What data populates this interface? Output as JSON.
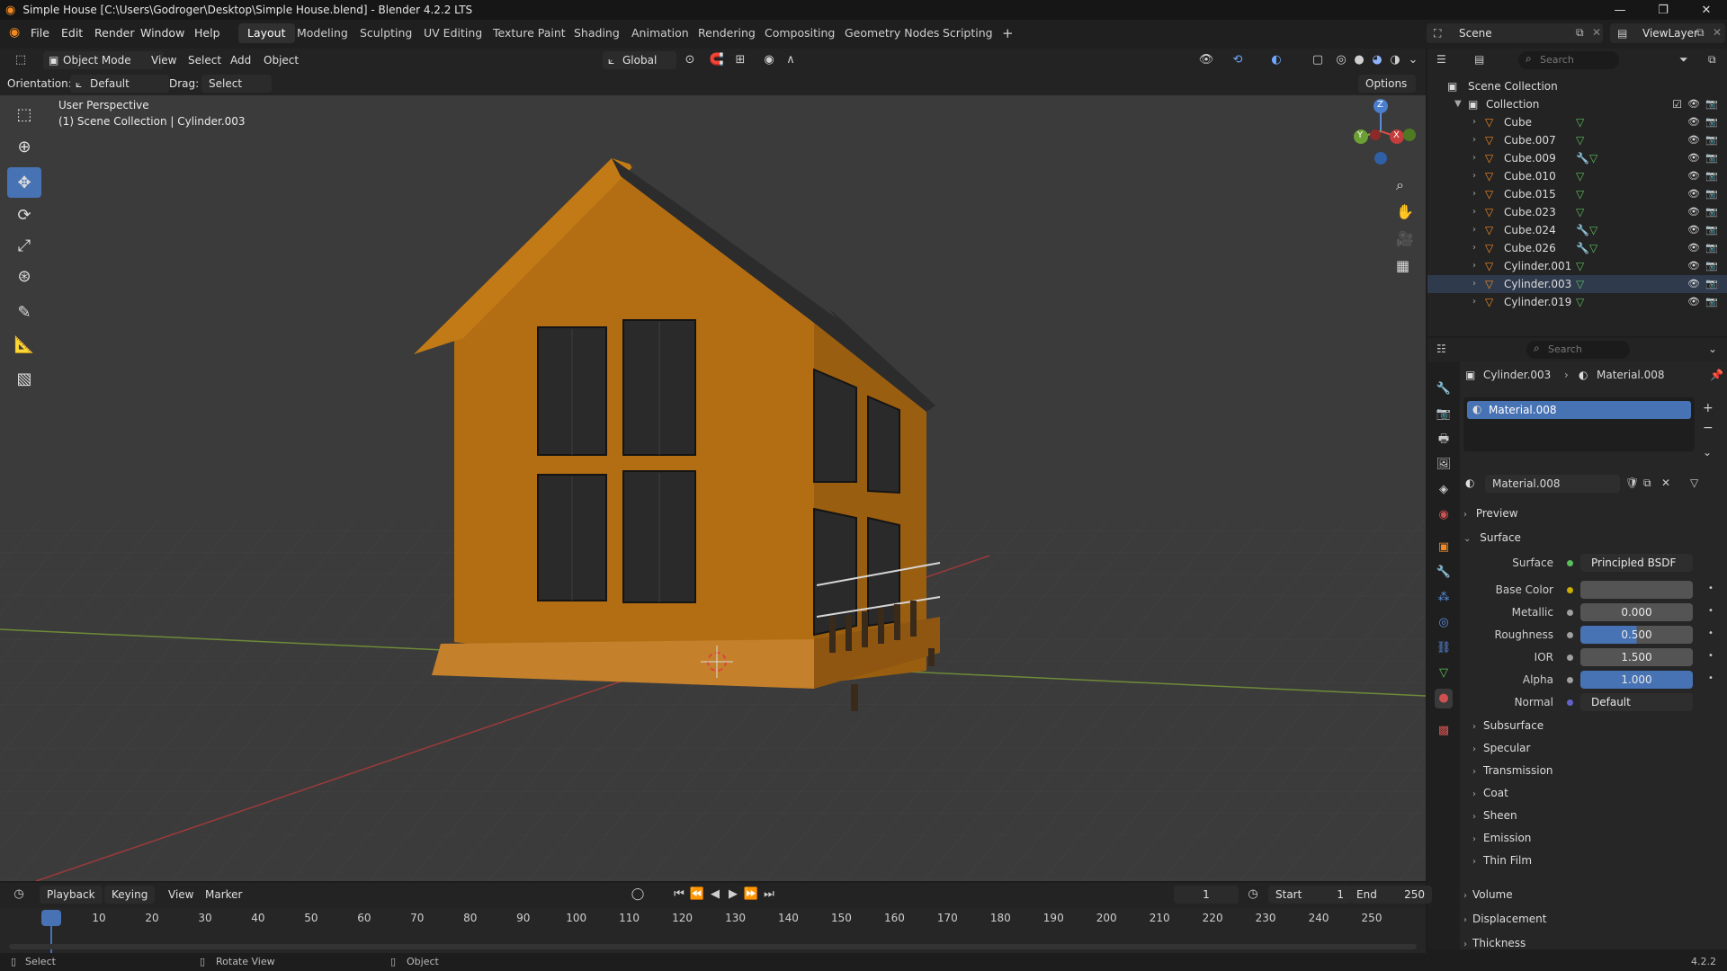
{
  "window": {
    "title": "Simple House [C:\\Users\\Godroger\\Desktop\\Simple House.blend] - Blender 4.2.2 LTS",
    "minimize": "—",
    "maximize": "❐",
    "close": "✕"
  },
  "menu": [
    "File",
    "Edit",
    "Render",
    "Window",
    "Help"
  ],
  "workspaces": [
    "Layout",
    "Modeling",
    "Sculpting",
    "UV Editing",
    "Texture Paint",
    "Shading",
    "Animation",
    "Rendering",
    "Compositing",
    "Geometry Nodes",
    "Scripting"
  ],
  "workspace_add": "+",
  "scene": {
    "name": "Scene",
    "view_layer": "ViewLayer"
  },
  "viewport_header": {
    "mode": "Object Mode",
    "menus": [
      "View",
      "Select",
      "Add",
      "Object"
    ],
    "transform_orientation": "Global",
    "options": "Options"
  },
  "tool_header": {
    "orientation_label": "Orientation:",
    "orientation_value": "Default",
    "drag_label": "Drag:",
    "drag_value": "Select Box"
  },
  "viewport": {
    "perspective": "User Perspective",
    "context": "(1) Scene Collection | Cylinder.003",
    "gizmo_axes": [
      "Z",
      "Y",
      "X"
    ]
  },
  "outliner": {
    "search_placeholder": "Search",
    "root": "Scene Collection",
    "collection": "Collection",
    "items": [
      {
        "name": "Cube",
        "mods": false
      },
      {
        "name": "Cube.007",
        "mods": false
      },
      {
        "name": "Cube.009",
        "mods": true
      },
      {
        "name": "Cube.010",
        "mods": false
      },
      {
        "name": "Cube.015",
        "mods": false
      },
      {
        "name": "Cube.023",
        "mods": false
      },
      {
        "name": "Cube.024",
        "mods": true
      },
      {
        "name": "Cube.026",
        "mods": true
      },
      {
        "name": "Cylinder.001",
        "mods": false
      },
      {
        "name": "Cylinder.003",
        "mods": false,
        "active": true
      },
      {
        "name": "Cylinder.019",
        "mods": false
      }
    ]
  },
  "properties": {
    "search_placeholder": "Search",
    "breadcrumb_object": "Cylinder.003",
    "breadcrumb_material": "Material.008",
    "slot": "Material.008",
    "material_name": "Material.008",
    "sections": {
      "preview": "Preview",
      "surface": "Surface"
    },
    "surface_label": "Surface",
    "surface_value": "Principled BSDF",
    "fields": [
      {
        "label": "Base Color",
        "value": "",
        "style": "color",
        "dot": "#c9b000"
      },
      {
        "label": "Metallic",
        "value": "0.000",
        "style": "gray",
        "dot": "#a0a0a0"
      },
      {
        "label": "Roughness",
        "value": "0.500",
        "style": "half",
        "dot": "#a0a0a0"
      },
      {
        "label": "IOR",
        "value": "1.500",
        "style": "gray",
        "dot": "#a0a0a0"
      },
      {
        "label": "Alpha",
        "value": "1.000",
        "style": "blue",
        "dot": "#a0a0a0"
      },
      {
        "label": "Normal",
        "value": "Default",
        "style": "dark",
        "dot": "#6363c7"
      }
    ],
    "subsections": [
      "Subsurface",
      "Specular",
      "Transmission",
      "Coat",
      "Sheen",
      "Emission",
      "Thin Film"
    ],
    "bottom_sections": [
      "Volume",
      "Displacement",
      "Thickness"
    ]
  },
  "timeline": {
    "menus": [
      "Playback",
      "Keying",
      "View",
      "Marker"
    ],
    "current_frame": "1",
    "start_label": "Start",
    "start": "1",
    "end_label": "End",
    "end": "250",
    "ticks": [
      "1",
      "10",
      "20",
      "30",
      "40",
      "50",
      "60",
      "70",
      "80",
      "90",
      "100",
      "110",
      "120",
      "130",
      "140",
      "150",
      "160",
      "170",
      "180",
      "190",
      "200",
      "210",
      "220",
      "230",
      "240",
      "250"
    ]
  },
  "statusbar": {
    "select": "Select",
    "rotate": "Rotate View",
    "object": "Object",
    "version": "4.2.2"
  }
}
